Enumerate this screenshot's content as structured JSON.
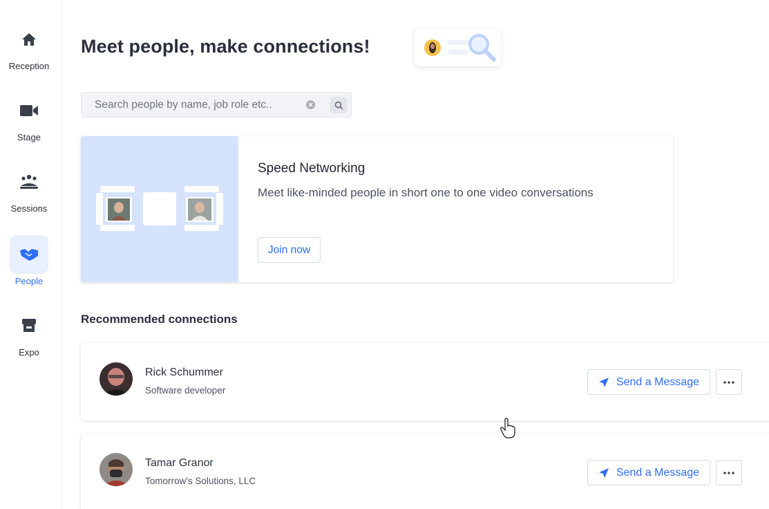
{
  "sidebar": {
    "items": [
      {
        "label": "Reception",
        "icon": "home-icon"
      },
      {
        "label": "Stage",
        "icon": "video-camera-icon"
      },
      {
        "label": "Sessions",
        "icon": "group-icon"
      },
      {
        "label": "People",
        "icon": "handshake-icon",
        "active": true
      },
      {
        "label": "Expo",
        "icon": "storefront-icon"
      }
    ]
  },
  "header": {
    "title": "Meet people, make connections!"
  },
  "search": {
    "placeholder": "Search people by name, job role etc..",
    "value": ""
  },
  "speed_networking": {
    "title": "Speed Networking",
    "description": "Meet like-minded people in short one to one video conversations",
    "join_label": "Join now"
  },
  "recommended": {
    "title": "Recommended connections",
    "people": [
      {
        "name": "Rick Schummer",
        "role": "Software developer",
        "message_label": "Send a Message"
      },
      {
        "name": "Tamar Granor",
        "role": "Tomorrow's Solutions, LLC",
        "message_label": "Send a Message"
      }
    ]
  },
  "colors": {
    "accent": "#2f6df6",
    "active_bg": "#e8efff",
    "illustration_bg": "#d6e3fd"
  }
}
